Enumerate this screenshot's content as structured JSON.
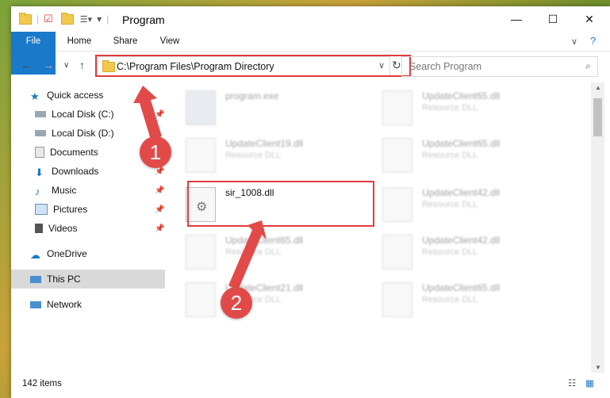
{
  "window": {
    "title": "Program"
  },
  "ribbon": {
    "tabs": [
      "File",
      "Home",
      "Share",
      "View"
    ]
  },
  "address": {
    "path": "C:\\Program Files\\Program Directory"
  },
  "search": {
    "placeholder": "Search Program"
  },
  "sidebar": {
    "items": [
      {
        "label": "Quick access"
      },
      {
        "label": "Local Disk (C:)"
      },
      {
        "label": "Local Disk (D:)"
      },
      {
        "label": "Documents"
      },
      {
        "label": "Downloads"
      },
      {
        "label": "Music"
      },
      {
        "label": "Pictures"
      },
      {
        "label": "Videos"
      },
      {
        "label": "OneDrive"
      },
      {
        "label": "This PC"
      },
      {
        "label": "Network"
      }
    ]
  },
  "files": [
    {
      "name": "program.exe",
      "type": ""
    },
    {
      "name": "UpdateClient65.dll",
      "type": "Resource DLL"
    },
    {
      "name": "UpdateClient19.dll",
      "type": "Resource DLL"
    },
    {
      "name": "UpdateClient65.dll",
      "type": "Resource DLL"
    },
    {
      "name": "sir_1008.dll",
      "type": ""
    },
    {
      "name": "UpdateClient42.dll",
      "type": "Resource DLL"
    },
    {
      "name": "UpdateClient65.dll",
      "type": "Resource DLL"
    },
    {
      "name": "UpdateClient42.dll",
      "type": "Resource DLL"
    },
    {
      "name": "UpdateClient21.dll",
      "type": "Resource DLL"
    },
    {
      "name": "UpdateClient65.dll",
      "type": "Resource DLL"
    }
  ],
  "status": {
    "count": "142 items"
  },
  "annotations": [
    "1",
    "2"
  ],
  "colors": {
    "accent": "#1979ca",
    "highlight": "#e23b3b",
    "badge": "#e24a4a"
  }
}
